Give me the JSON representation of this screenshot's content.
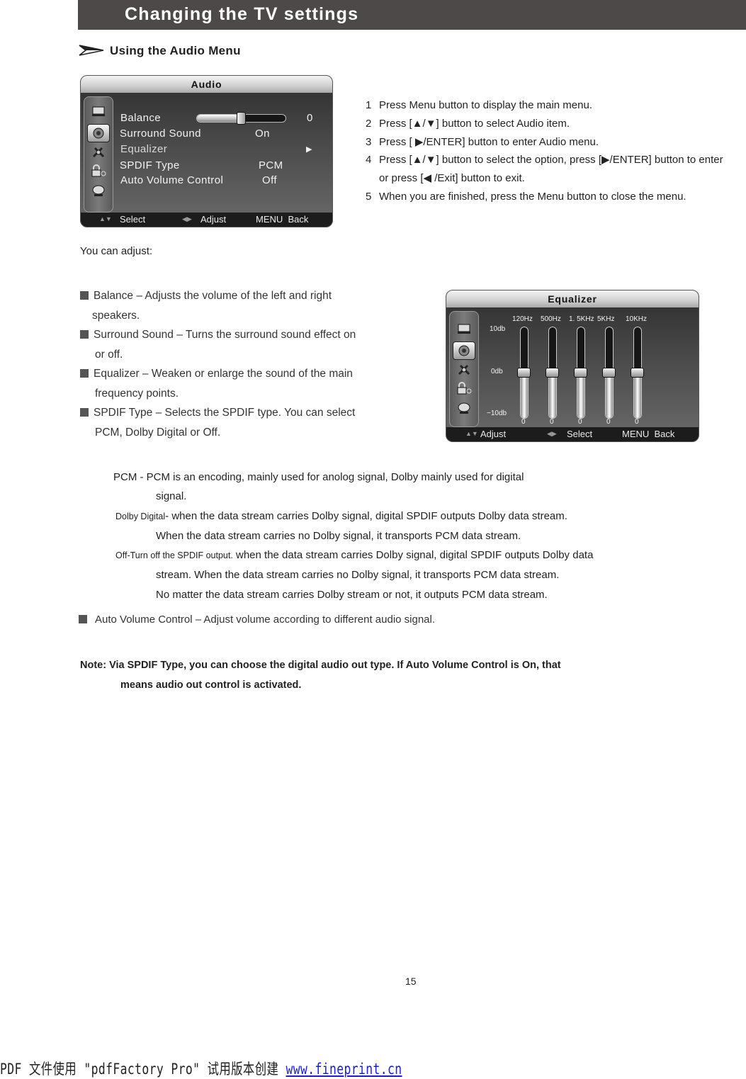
{
  "header": {
    "title": "Changing the TV settings"
  },
  "section": {
    "title": "Using the Audio Menu",
    "icon": "arrow-right-icon"
  },
  "audio_menu": {
    "title": "Audio",
    "side_icons": [
      "picture-icon",
      "audio-icon",
      "settings-icon",
      "lock-icon",
      "satellite-icon"
    ],
    "selected_icon": "audio-icon",
    "items": [
      {
        "label": "Balance",
        "value": "0",
        "slider_fraction": 0.5
      },
      {
        "label": "Surround Sound",
        "value": "On"
      },
      {
        "label": "Equalizer",
        "value": "▶"
      },
      {
        "label": "SPDIF  Type",
        "value": "PCM"
      },
      {
        "label": "Auto Volume Control",
        "value": "Off"
      }
    ],
    "footer": {
      "select": "Select",
      "adjust": "Adjust",
      "back": "MENU  Back"
    }
  },
  "steps": [
    {
      "num": "1",
      "text": "Press Menu button to display the main menu."
    },
    {
      "num": "2",
      "text": "Press [▲/▼] button to select Audio item."
    },
    {
      "num": "3",
      "text": "Press [ ▶/ENTER] button to enter Audio menu."
    },
    {
      "num": "4",
      "text": "Press [▲/▼] button to select the option, press [▶/ENTER] button to enter",
      "cont": "or press [◀ /Exit] button to exit."
    },
    {
      "num": "5",
      "text": "When you are finished, press the Menu button to close the menu."
    }
  ],
  "you_can_adjust": "You can adjust:",
  "bullets": [
    {
      "text": "Balance – Adjusts the volume of the left and right",
      "cont": "speakers."
    },
    {
      "text": "Surround Sound – Turns the surround sound effect on",
      "cont": "or off."
    },
    {
      "text": "Equalizer – Weaken or enlarge the sound of the main",
      "cont": "frequency points."
    },
    {
      "text": "SPDIF Type – Selects the SPDIF type.  You can select",
      "cont": "PCM,  Dolby Digital or Off."
    }
  ],
  "equalizer_menu": {
    "title": "Equalizer",
    "scale": {
      "top": "10db",
      "mid": "0db",
      "bottom": "−10db"
    },
    "bands": [
      {
        "label": "120Hz",
        "value": "0"
      },
      {
        "label": "500Hz",
        "value": "0"
      },
      {
        "label": "1. 5KHz",
        "value": "0"
      },
      {
        "label": "5KHz",
        "value": "0"
      },
      {
        "label": "10KHz",
        "value": "0"
      }
    ],
    "footer": {
      "adjust": "Adjust",
      "select": "Select",
      "back": "MENU  Back"
    }
  },
  "definitions": [
    {
      "term": "PCM - ",
      "text": "PCM  is  an  encoding,  mainly  used  for  anolog  signal,  Dolby  mainly  used  for  digital",
      "cont": [
        "signal."
      ]
    },
    {
      "term": "Dolby Digital",
      "text": "- when the data stream carries Dolby signal, digital SPDIF outputs Dolby data stream.",
      "cont": [
        "When the data stream carries no Dolby signal, it transports PCM data stream."
      ]
    },
    {
      "term": "Off-Turn off the SPDIF output.",
      "text": " when the data stream carries Dolby signal, digital SPDIF outputs Dolby data",
      "cont": [
        "stream. When the data stream carries no Dolby signal, it transports PCM data stream.",
        "No matter the data stream carries Dolby stream or not, it outputs PCM data stream."
      ]
    }
  ],
  "auto_volume": "Auto Volume Control  –  Adjust volume according to different audio signal.",
  "note": {
    "label": "Note:",
    "text": " Via SPDIF Type,  you can choose the digital audio out type.  If Auto Volume Control is On,  that",
    "cont": "means audio out control is activated."
  },
  "page_number": "15",
  "watermark": {
    "text": "PDF 文件使用 \"pdfFactory Pro\" 试用版本创建 ",
    "link": "www.fineprint.cn"
  }
}
